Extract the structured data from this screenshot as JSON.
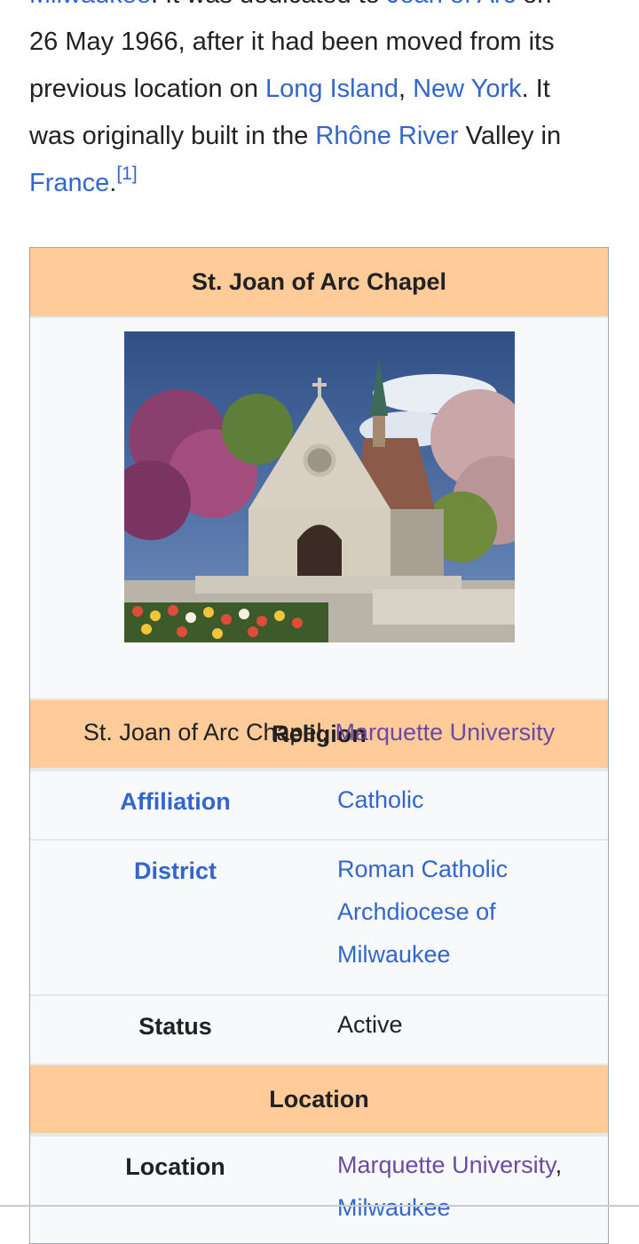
{
  "intro": {
    "line0_a": "Milwaukee",
    "line0_b": ". It was dedicated to ",
    "line0_c": "Joan of Arc",
    "line0_d": " on",
    "line1": "26 May 1966, after it had been moved from its",
    "line2_a": "previous location on ",
    "line2_link1": "Long Island",
    "line2_sep": ", ",
    "line2_link2": "New York",
    "line2_b": ". It",
    "line3_a": "was originally built in the ",
    "line3_link": "Rhône River",
    "line3_b": " Valley in",
    "line4_link": "France",
    "line4_b": ".",
    "footnote": "[1]"
  },
  "infobox": {
    "title": "St. Joan of Arc Chapel",
    "image_icon": "chapel-photo",
    "caption_text": "St. Joan of Arc Chapel, ",
    "caption_link": "Marquette University",
    "section_religion": "Religion",
    "affiliation_label": "Affiliation",
    "affiliation_value": "Catholic",
    "district_label": "District",
    "district_value_1": "Roman Catholic",
    "district_value_2": "Archdiocese of",
    "district_value_3": "Milwaukee",
    "status_label": "Status",
    "status_value": "Active",
    "section_location": "Location",
    "location_label": "Location",
    "location_value_1": "Marquette University",
    "location_sep": ",",
    "location_value_2": "Milwaukee"
  },
  "colors": {
    "header_bg": "#ffcc99",
    "link": "#3366cc",
    "visited_link": "#6b4ba1",
    "infobox_bg": "#f8f9fa"
  }
}
